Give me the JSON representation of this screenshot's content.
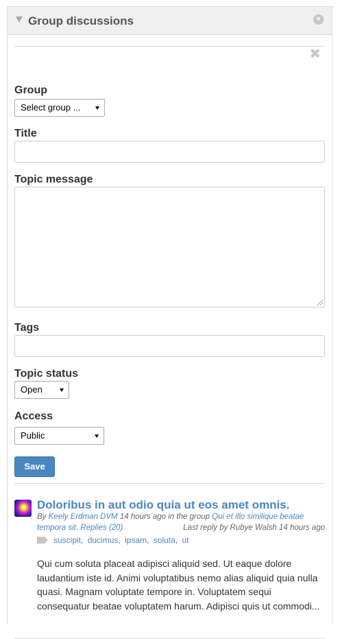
{
  "widget": {
    "title": "Group discussions",
    "close_glyph": "×",
    "collapse_icon": "triangle-down-icon"
  },
  "form": {
    "cancel_glyph": "✖",
    "group_label": "Group",
    "group_selected": "Select group ...",
    "title_label": "Title",
    "title_value": "",
    "message_label": "Topic message",
    "message_value": "",
    "tags_label": "Tags",
    "tags_value": "",
    "status_label": "Topic status",
    "status_selected": "Open",
    "access_label": "Access",
    "access_selected": "Public",
    "save_label": "Save"
  },
  "topic": {
    "title": "Doloribus in aut odio quia ut eos amet omnis.",
    "by_prefix": "By ",
    "author": "Keely Erdman DVM",
    "time_text": " 14 hours ago in the group ",
    "group_name_line1": "Qui et illo similique beatae",
    "group_name_line2": "tempora sit.",
    "replies": "Replies (20)",
    "last_reply_prefix": "Last reply by ",
    "last_reply_author": "Rubye Walsh",
    "last_reply_time": " 14 hours ago",
    "tags": [
      "suscipit",
      "ducimus",
      "ipsam",
      "soluta",
      "ut"
    ],
    "excerpt": "Qui cum soluta placeat adipisci aliquid sed. Ut eaque dolore laudantium iste id. Animi voluptatibus nemo alias aliquid quia nulla quasi. Magnam voluptate tempore in. Voluptatem sequi consequatur beatae voluptatem harum. Adipisci quis ut commodi..."
  },
  "colors": {
    "accent": "#4a86c0",
    "header_bg": "#f0f0f0",
    "border": "#dddddd"
  }
}
